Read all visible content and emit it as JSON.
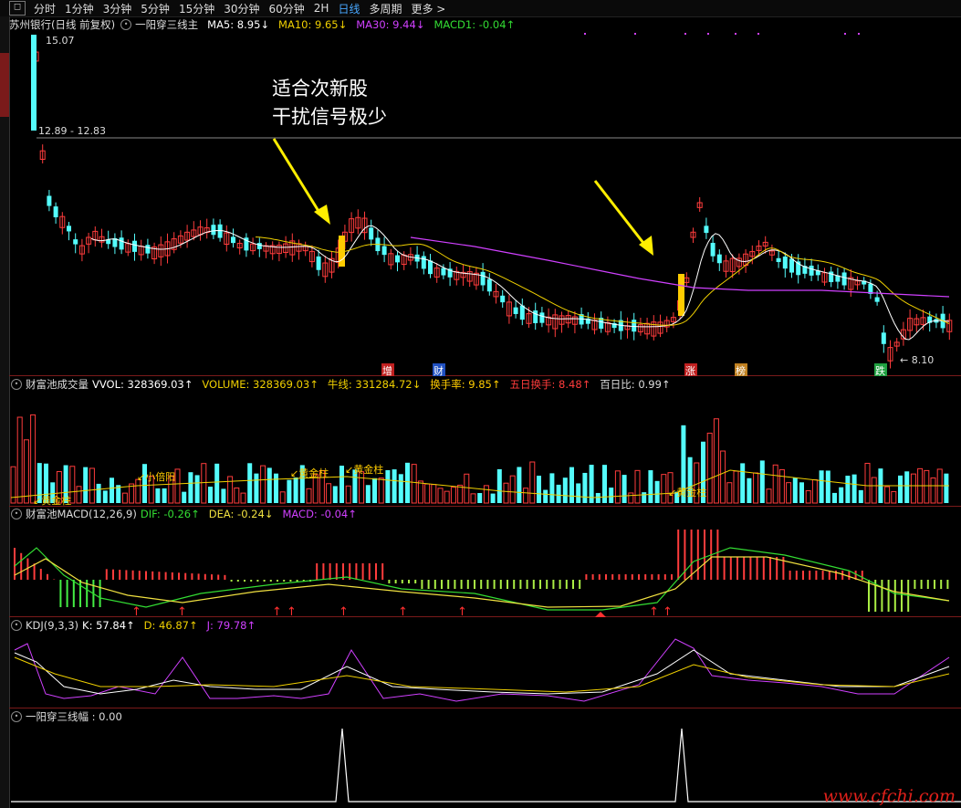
{
  "toolbar": {
    "back_icon": "back-square-icon",
    "periods": [
      "分时",
      "1分钟",
      "3分钟",
      "5分钟",
      "15分钟",
      "30分钟",
      "60分钟",
      "2H",
      "日线",
      "多周期",
      "更多 >"
    ],
    "active_period": "日线"
  },
  "main_pane": {
    "title": "苏州银行(日线 前复权)",
    "indicator": "一阳穿三线主",
    "ma5": "MA5: 8.95↓",
    "ma10": "MA10: 9.65↓",
    "ma30": "MA30: 9.44↓",
    "macd1": "MACD1: -0.04↑",
    "high_label": "15.07",
    "low_label": "8.10",
    "hline_label": "12.89 - 12.83",
    "tags": [
      "增",
      "财",
      "涨",
      "榜",
      "跌"
    ]
  },
  "annotation": {
    "line1": "适合次新股",
    "line2": "干扰信号极少"
  },
  "volume_pane": {
    "title": "财富池成交量",
    "vol": "VVOL: 328369.03↑",
    "volume": "VOLUME: 328369.03↑",
    "niuxian": "牛线: 331284.72↓",
    "turnover": "换手率: 9.85↑",
    "five_day": "五日换手: 8.48↑",
    "bairibi": "百日比: 0.99↑",
    "labels": [
      "黄金柱",
      "小倍阳",
      "黄金柱",
      "黄金柱",
      "黄金柱"
    ]
  },
  "macd_pane": {
    "title": "财富池MACD(12,26,9)",
    "dif": "DIF: -0.26↑",
    "dea": "DEA: -0.24↓",
    "macd": "MACD: -0.04↑"
  },
  "kdj_pane": {
    "title": "KDJ(9,3,3)",
    "k": "K: 57.84↑",
    "d": "D: 46.87↑",
    "j": "J: 79.78↑"
  },
  "bottom_pane": {
    "title": "一阳穿三线幅 : 0.00"
  },
  "watermark": "www.cfchi.com",
  "colors": {
    "up": "#ff3c3c",
    "down": "#54fcfc",
    "ma5": "#ffffff",
    "ma10": "#f0d000",
    "ma30": "#d040ff",
    "highlight": "#ffcc00",
    "dif": "#33dd33",
    "dea": "#f0e040"
  }
}
